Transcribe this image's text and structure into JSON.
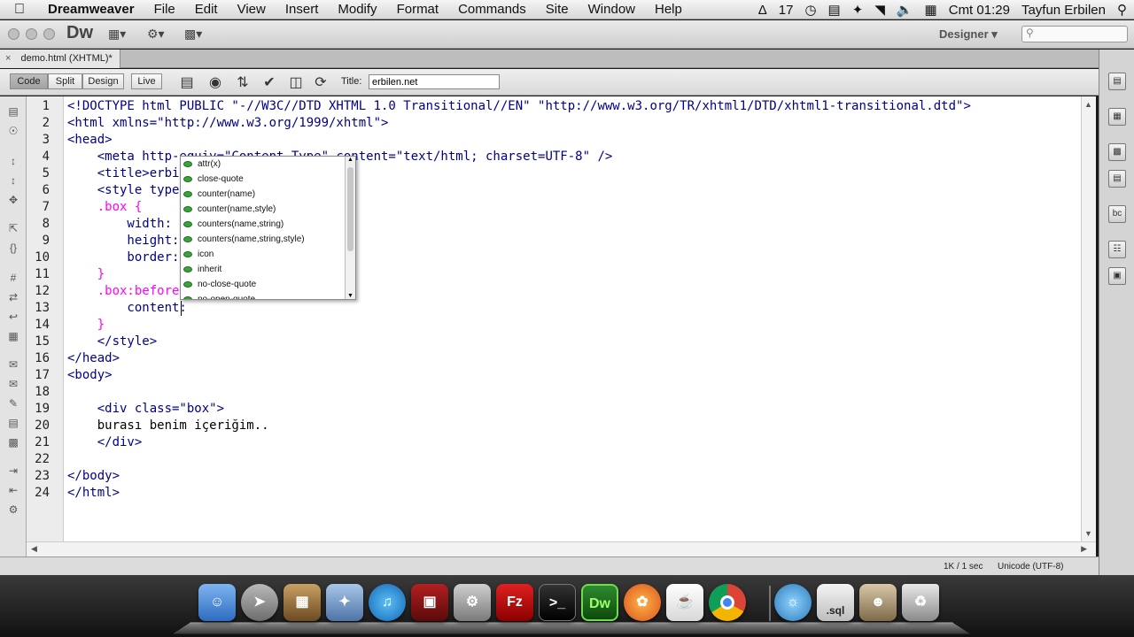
{
  "menubar": {
    "app": "Dreamweaver",
    "items": [
      "File",
      "Edit",
      "View",
      "Insert",
      "Modify",
      "Format",
      "Commands",
      "Site",
      "Window",
      "Help"
    ],
    "status_count": "17",
    "clock": "Cmt 01:29",
    "user": "Tayfun Erbilen"
  },
  "app": {
    "logo": "Dw",
    "workspace": "Designer"
  },
  "document": {
    "tab": "demo.html (XHTML)*",
    "views": [
      "Code",
      "Split",
      "Design",
      "Live"
    ],
    "active_view": "Code",
    "title_label": "Title:",
    "title_value": "erbilen.net"
  },
  "code": {
    "line_numbers": [
      "1",
      "2",
      "3",
      "4",
      "5",
      "6",
      "7",
      "8",
      "9",
      "10",
      "11",
      "12",
      "13",
      "14",
      "15",
      "16",
      "17",
      "18",
      "19",
      "20",
      "21",
      "22",
      "23",
      "24"
    ],
    "lines": [
      "<!DOCTYPE html PUBLIC \"-//W3C//DTD XHTML 1.0 Transitional//EN\" \"http://www.w3.org/TR/xhtml1/DTD/xhtml1-transitional.dtd\">",
      "<html xmlns=\"http://www.w3.org/1999/xhtml\">",
      "<head>",
      "    <meta http-equiv=\"Content-Type\" content=\"text/html; charset=UTF-8\" />",
      "    <title>erbil",
      "    <style type=",
      "    .box {",
      "        width: 5",
      "        height:",
      "        border:",
      "    }",
      "    .box:before",
      "        content:",
      "    }",
      "    </style>",
      "</head>",
      "<body>",
      "",
      "    <div class=\"box\">",
      "    burası benim içeriğim..",
      "    </div>",
      "",
      "</body>",
      "</html>"
    ]
  },
  "autocomplete": {
    "items": [
      "attr(x)",
      "close-quote",
      "counter(name)",
      "counter(name,style)",
      "counters(name,string)",
      "counters(name,string,style)",
      "icon",
      "inherit",
      "no-close-quote",
      "no-open-quote"
    ]
  },
  "status": {
    "size": "1K / 1 sec",
    "encoding": "Unicode (UTF-8)"
  },
  "dock": {
    "apps": [
      "finder",
      "launchpad",
      "preview",
      "mail",
      "itunes",
      "photo-booth",
      "system-preferences",
      "filezilla",
      "terminal",
      "dreamweaver",
      "firefox",
      "java",
      "chrome",
      "network-utility",
      "sql-file",
      "contact-photo",
      "trash"
    ],
    "labels": {
      "dreamweaver": "Dw",
      "filezilla": "Fz",
      "sql": ".sql"
    }
  },
  "colors": {
    "tag": "#000088",
    "selector": "#ff00ff",
    "autocomplete_icon": "#3aa33a"
  }
}
